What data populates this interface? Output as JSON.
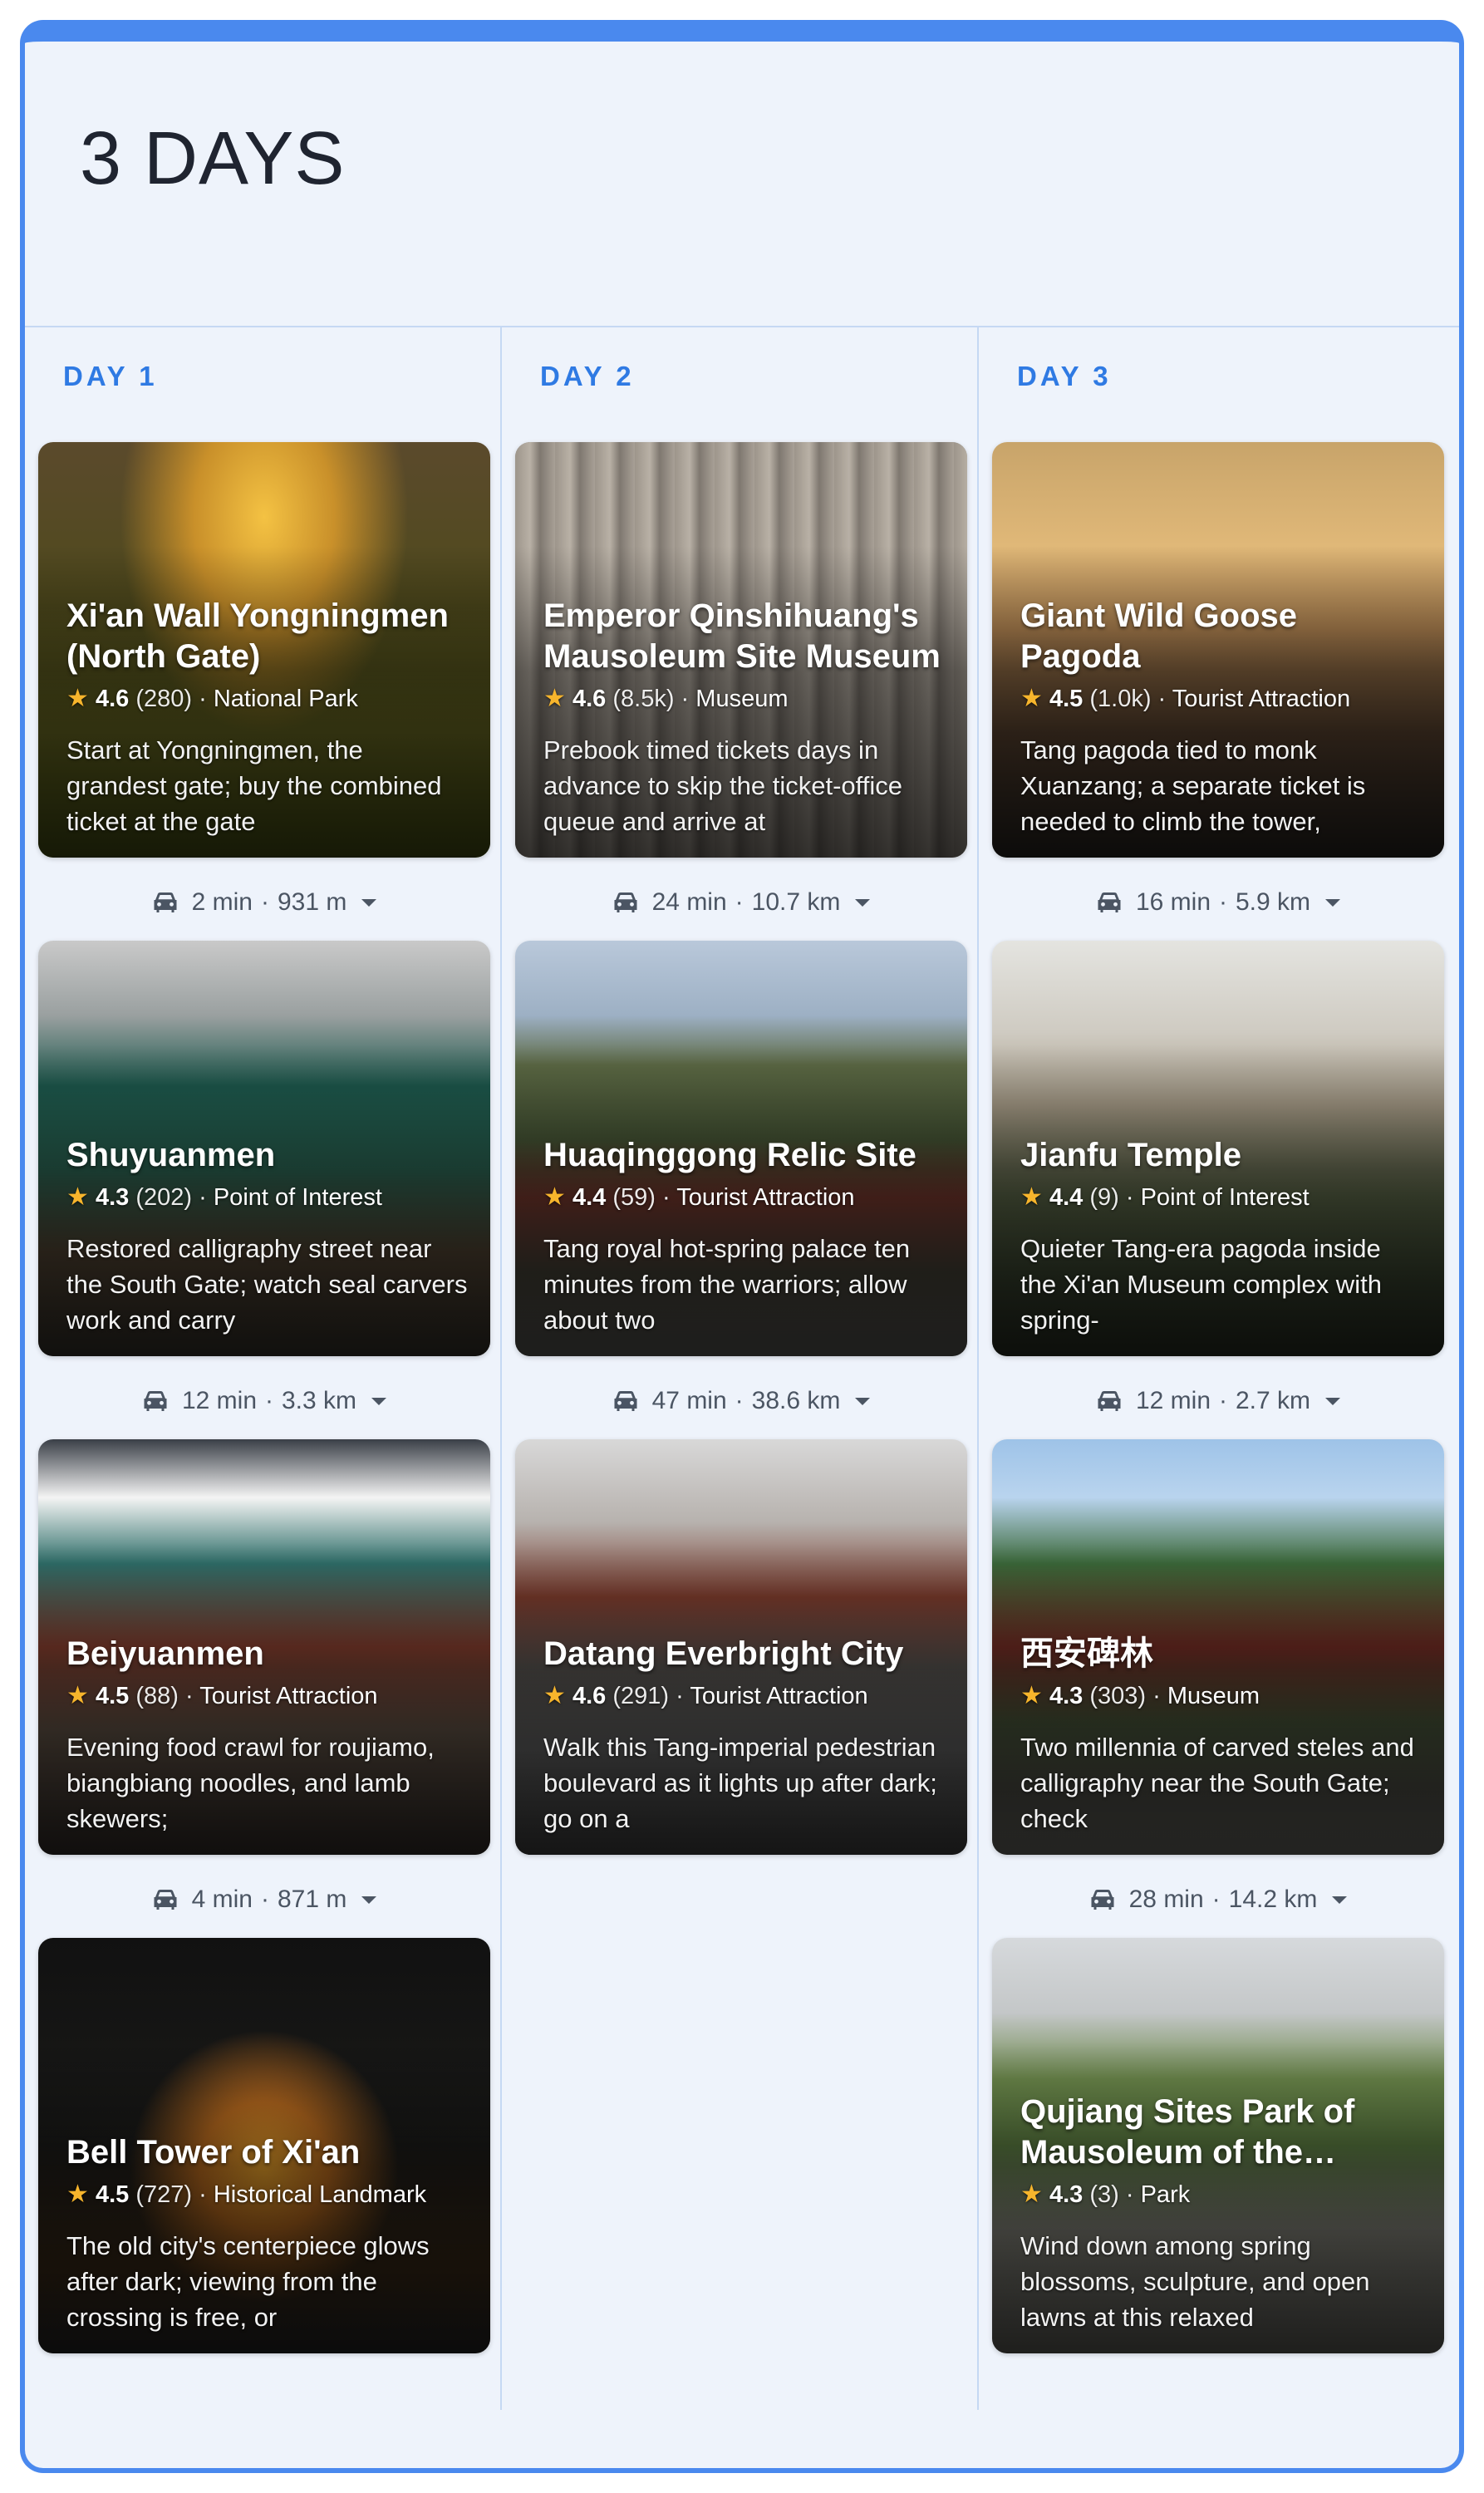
{
  "title": "3 DAYS",
  "days": [
    {
      "label": "DAY 1",
      "places": [
        {
          "name": "Xi'an Wall Yongningmen (North Gate)",
          "rating": "4.6",
          "count": "(280)",
          "category": "National Park",
          "desc": "Start at Yongningmen, the grandest gate; buy the combined ticket at the gate"
        },
        {
          "name": "Shuyuanmen",
          "rating": "4.3",
          "count": "(202)",
          "category": "Point of Interest",
          "desc": "Restored calligraphy street near the South Gate; watch seal carvers work and carry"
        },
        {
          "name": "Beiyuanmen",
          "rating": "4.5",
          "count": "(88)",
          "category": "Tourist Attraction",
          "desc": "Evening food crawl for roujiamo, biangbiang noodles, and lamb skewers;"
        },
        {
          "name": "Bell Tower of Xi'an",
          "rating": "4.5",
          "count": "(727)",
          "category": "Historical Landmark",
          "desc": "The old city's centerpiece glows after dark; viewing from the crossing is free, or"
        }
      ],
      "travel": [
        {
          "time": "2 min",
          "dist": "931 m"
        },
        {
          "time": "12 min",
          "dist": "3.3 km"
        },
        {
          "time": "4 min",
          "dist": "871 m"
        }
      ]
    },
    {
      "label": "DAY 2",
      "places": [
        {
          "name": "Emperor Qinshihuang's Mausoleum Site Museum",
          "rating": "4.6",
          "count": "(8.5k)",
          "category": "Museum",
          "desc": "Prebook timed tickets days in advance to skip the ticket-office queue and arrive at"
        },
        {
          "name": "Huaqinggong Relic Site",
          "rating": "4.4",
          "count": "(59)",
          "category": "Tourist Attraction",
          "desc": "Tang royal hot-spring palace ten minutes from the warriors; allow about two"
        },
        {
          "name": "Datang Everbright City",
          "rating": "4.6",
          "count": "(291)",
          "category": "Tourist Attraction",
          "desc": "Walk this Tang-imperial pedestrian boulevard as it lights up after dark; go on a"
        }
      ],
      "travel": [
        {
          "time": "24 min",
          "dist": "10.7 km"
        },
        {
          "time": "47 min",
          "dist": "38.6 km"
        }
      ]
    },
    {
      "label": "DAY 3",
      "places": [
        {
          "name": "Giant Wild Goose Pagoda",
          "rating": "4.5",
          "count": "(1.0k)",
          "category": "Tourist Attraction",
          "desc": "Tang pagoda tied to monk Xuanzang; a separate ticket is needed to climb the tower,"
        },
        {
          "name": "Jianfu Temple",
          "rating": "4.4",
          "count": "(9)",
          "category": "Point of Interest",
          "desc": "Quieter Tang-era pagoda inside the Xi'an Museum complex with spring-"
        },
        {
          "name": "西安碑林",
          "rating": "4.3",
          "count": "(303)",
          "category": "Museum",
          "desc": "Two millennia of carved steles and calligraphy near the South Gate; check"
        },
        {
          "name": "Qujiang Sites Park of Mausoleum of the Seco…",
          "rating": "4.3",
          "count": "(3)",
          "category": "Park",
          "desc": "Wind down among spring blossoms, sculpture, and open lawns at this relaxed"
        }
      ],
      "travel": [
        {
          "time": "16 min",
          "dist": "5.9 km"
        },
        {
          "time": "12 min",
          "dist": "2.7 km"
        },
        {
          "time": "28 min",
          "dist": "14.2 km"
        }
      ]
    }
  ],
  "icons": {
    "car": "car-icon",
    "star": "star-icon",
    "dropdown": "caret-down-icon"
  },
  "colors": {
    "accent": "#4a89ee",
    "day_label": "#2f7ae3",
    "star": "#f7b52c",
    "panel_bg": "#eef3fb"
  }
}
